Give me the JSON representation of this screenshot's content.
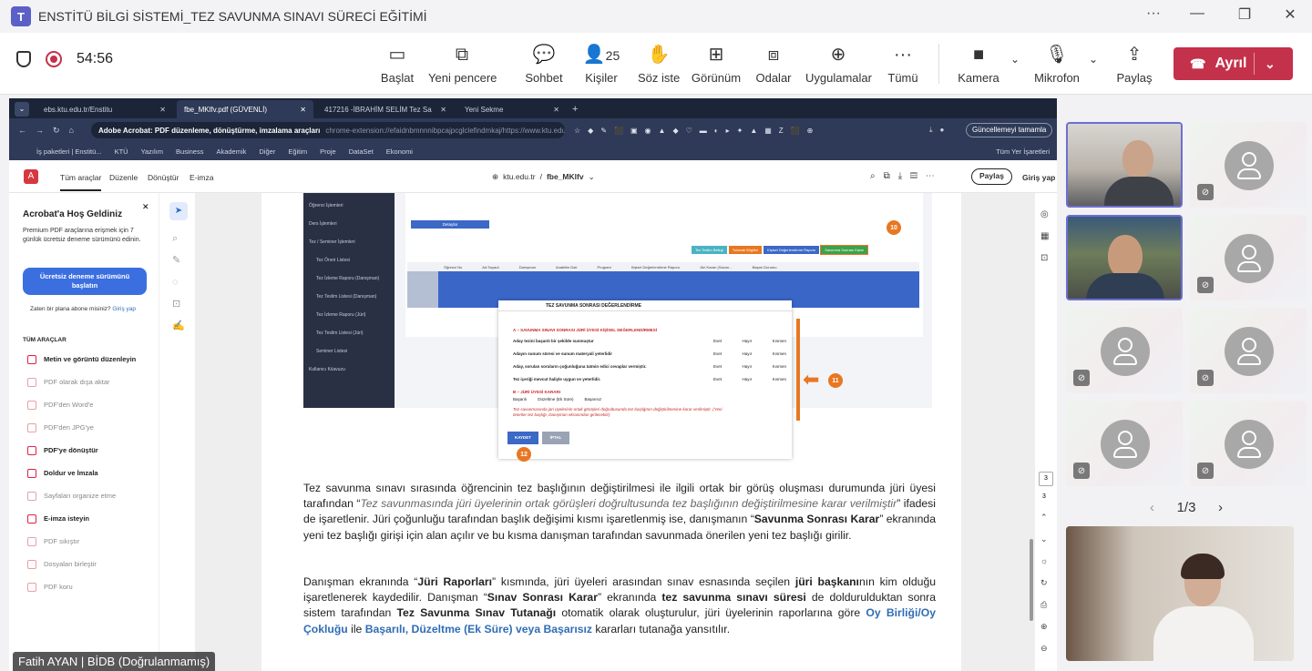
{
  "window": {
    "title": "ENSTİTÜ BİLGİ SİSTEMİ_TEZ SAVUNMA SINAVI SÜRECİ EĞİTİMİ",
    "more": "···",
    "minimize": "—",
    "maximize": "❐",
    "close": "✕"
  },
  "meeting": {
    "timer": "54:56",
    "toolbar": [
      {
        "label": "Başlat",
        "icon": "▭"
      },
      {
        "label": "Yeni pencere",
        "icon": "⧉"
      },
      {
        "label": "Sohbet",
        "icon": "💬"
      },
      {
        "label": "Kişiler",
        "icon": "👤",
        "count": "25"
      },
      {
        "label": "Söz iste",
        "icon": "✋"
      },
      {
        "label": "Görünüm",
        "icon": "⊞"
      },
      {
        "label": "Odalar",
        "icon": "⧈"
      },
      {
        "label": "Uygulamalar",
        "icon": "⊕"
      },
      {
        "label": "Tümü",
        "icon": "···"
      },
      {
        "label": "Kamera",
        "icon": "■"
      },
      {
        "label": "Mikrofon",
        "icon": "🎙"
      },
      {
        "label": "Paylaş",
        "icon": "⇪"
      }
    ],
    "leave_label": "Ayrıl",
    "pager": "1/3",
    "presenter_name": "Fatih AYAN | BİDB (Doğrulanmamış)"
  },
  "browser": {
    "tabs": [
      "ebs.ktu.edu.tr/Enstitu",
      "fbe_MKlfv.pdf (GÜVENLİ)",
      "417216 -İBRAHİM SELİM Tez Sa",
      "Yeni Sekme"
    ],
    "url_title": "Adobe Acrobat: PDF düzenleme, dönüştürme, imzalama araçları",
    "url": "chrome-extension://efaidnbmnnnibpcajpcglclefindmkaj/https://www.ktu.edu...",
    "update_label": "Güncellemeyi tamamla",
    "bookmarks": [
      "İş paketleri | Enstitü...",
      "KTÜ",
      "Yazılım",
      "Business",
      "Akademik",
      "Diğer",
      "Eğitim",
      "Proje",
      "DataSet",
      "Ekonomi"
    ],
    "all_bookmarks": "Tüm Yer İşaretleri"
  },
  "acrobat": {
    "tabs": [
      "Tüm araçlar",
      "Düzenle",
      "Dönüştür",
      "E-imza"
    ],
    "crumb_host": "ktu.edu.tr",
    "crumb_sep": "/",
    "crumb_file": "fbe_MKlfv",
    "share_label": "Paylaş",
    "signin_label": "Giriş yap",
    "welcome_title": "Acrobat'a Hoş Geldiniz",
    "welcome_text": "Premium PDF araçlarına erişmek için 7 günlük ücretsiz deneme sürümünü edinin.",
    "trial_button": "Ücretsiz deneme sürümünü başlatın",
    "have_plan": "Zaten bir plana abone misiniz?",
    "signin_link": "Giriş yap",
    "all_tools_header": "TÜM ARAÇLAR",
    "tools": [
      "Metin ve görüntü düzenleyin",
      "PDF olarak dışa aktar",
      "PDF'den Word'e",
      "PDF'den JPG'ye",
      "PDF'ye dönüştür",
      "Doldur ve İmzala",
      "Sayfaları organize etme",
      "E-imza isteyin",
      "PDF sıkıştır",
      "Dosyaları birleştir",
      "PDF koru"
    ],
    "page_number": "3",
    "page_count": "3"
  },
  "shot": {
    "menu": [
      "Öğrenci İşlemleri",
      "Ders İşlemleri",
      "Tez / Seminer İşlemleri",
      "Tez Öneri Listesi",
      "Tez İzleme Raporu (Danışman)",
      "Tez Teslim Listesi (Danışman)",
      "Tez İzleme Raporu (Jüri)",
      "Tez Teslim Listesi (Jüri)",
      "Seminer Listesi",
      "Kullanıcı Kılavuzu"
    ],
    "button": "Detaylar",
    "action_buttons": [
      "Tez Teslim Belirgi",
      "Tutanak Bilgileri",
      "Kişisel Değerlendirme Raporu",
      "Savunma Sonrası Karar"
    ],
    "columns": [
      "Öğrenci No",
      "Ad Soyadı",
      "Danışman",
      "Anabilim Dalı",
      "Program",
      "Kişisel Değerlendirme Raporu",
      "Jüri Kararı (Savun...",
      "Başarı Durumu"
    ],
    "badges": [
      "10",
      "11",
      "12"
    ],
    "dialog_title": "TEZ SAVUNMA SONRASI DEĞERLENDİRME",
    "section_a": "A – SAVUNMA SINAVI SONRASI JÜRİ ÜYESİ KİŞİSEL DEĞERLENDİRMESİ",
    "questions": [
      "Aday tezini başarılı bir şekilde sunmuştur",
      "Adayın sunum süresi ve sunum materyali yeterlidir",
      "Aday, sorulan soruların çoğunluğuna tatmin edici cevaplar vermiştir.",
      "Tez içeriği mevcut haliyle uygun ve yeterlidir."
    ],
    "options": [
      "Evet",
      "Hayır",
      "Kısmen"
    ],
    "section_b": "B – JÜRİ ÜYESİ KARARI",
    "decisions": [
      "Başarılı",
      "Düzeltme (Ek Süre)",
      "Başarısız"
    ],
    "note": "Tez savunmasında jüri üyelerinin ortak görüşleri doğrultusunda tez başlığının değiştirilmesine karar verilmiştir. (Yeni öneriler tez başlığı, Danışman ekranından girilecektir)",
    "save": "KAYDET",
    "cancel": "İPTAL"
  },
  "para1": {
    "t1": "Tez savunma sınavı sırasında öğrencinin tez başlığının değiştirilmesi ile ilgili ortak bir görüş oluşması durumunda jüri üyesi tarafından “",
    "i1": "Tez savunmasında jüri üyelerinin ortak görüşleri doğrultusunda tez başlığının değiştirilmesine karar verilmiştir",
    "t2": "” ifadesi de işaretlenir. Jüri çoğunluğu tarafından başlık değişimi kısmı işaretlenmiş ise, danışmanın “",
    "b1": "Savunma Sonrası Karar",
    "t3": "” ekranında yeni tez başlığı girişi için alan açılır ve bu kısma danışman tarafından savunmada önerilen yeni tez başlığı girilir."
  },
  "para2": {
    "t1": "Danışman ekranında “",
    "b1": "Jüri Raporları",
    "t2": "” kısmında, jüri üyeleri arasından sınav esnasında seçilen ",
    "b2": "jüri başkanı",
    "t3": "nın kim olduğu işaretlenerek kaydedilir. Danışman “",
    "b3": "Sınav Sonrası Karar",
    "t4": "” ekranında ",
    "b4": "tez savunma sınavı süresi",
    "t5": " de doldurulduktan sonra sistem tarafından ",
    "b5": "Tez Savunma Sınav Tutanağı",
    "t6": " otomatik olarak oluşturulur, jüri üyelerinin raporlarına göre ",
    "c1": "Oy Birliği/Oy Çokluğu",
    "t7": " ile ",
    "c2": "Başarılı, Düzeltme (Ek Süre) veya Başarısız",
    "t8": " kararları tutanağa yansıtılır."
  },
  "colors": {
    "accent": "#6264a7",
    "leave": "#c4314b",
    "badge": "#e87722",
    "link": "#2f6db5",
    "trial": "#3b6fe0"
  }
}
